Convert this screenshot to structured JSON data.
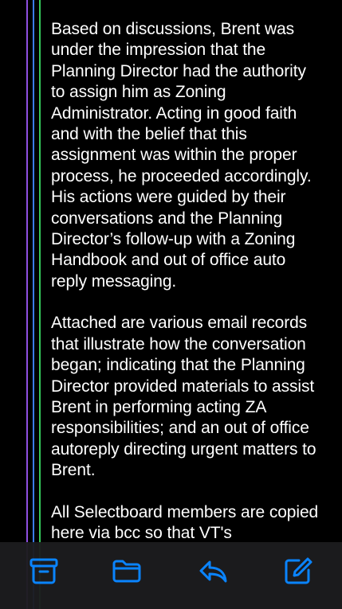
{
  "message": {
    "paragraphs": [
      "Based on discussions, Brent was under the impression that the Planning Director had the authority to assign him as Zoning Administrator. Acting in good faith and with the belief that this assignment was within the proper process, he proceeded accordingly. His actions were guided by their conversations and the Planning Director’s follow-up with a Zoning Handbook and out of office auto reply messaging.",
      "Attached are various email records that illustrate how the conversation began; indicating that the Planning Director provided materials to assist Brent in performing acting ZA responsibilities; and an out of office autoreply directing urgent matters to Brent.",
      "All Selectboard members are copied here via bcc so that VT's"
    ]
  },
  "quote_bars": {
    "colors": [
      "#8e4fe0",
      "#3b7bf5",
      "#34c759"
    ]
  },
  "toolbar": {
    "items": [
      {
        "icon": "archive-icon"
      },
      {
        "icon": "folder-icon"
      },
      {
        "icon": "reply-icon"
      },
      {
        "icon": "compose-icon"
      }
    ],
    "accent": "#0a84ff"
  }
}
